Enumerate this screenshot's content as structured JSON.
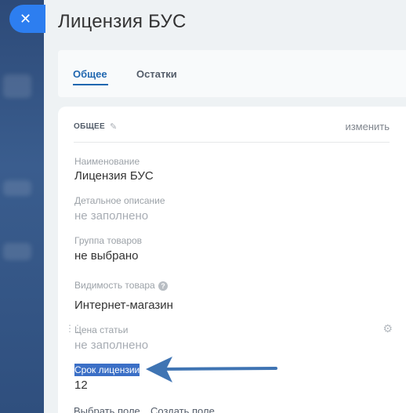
{
  "window": {
    "close_icon": "close-icon",
    "close_glyph": "✕"
  },
  "page": {
    "title": "Лицензия БУС"
  },
  "tabs": [
    {
      "label": "Общее",
      "active": true
    },
    {
      "label": "Остатки",
      "active": false
    }
  ],
  "section": {
    "header": "ОБЩЕЕ",
    "edit_label": "изменить",
    "fields": [
      {
        "label": "Наименование",
        "value": "Лицензия БУС"
      },
      {
        "label": "Детальное описание",
        "value": "не заполнено"
      },
      {
        "label": "Группа товаров",
        "value": "не выбрано"
      },
      {
        "label": "Видимость товара",
        "value": "Интернет-магазин",
        "help_icon": "help-icon"
      },
      {
        "label": "Цена статьи",
        "value": "не заполнено"
      },
      {
        "label": "Срок лицензии",
        "value": "12",
        "highlighted": true
      }
    ],
    "footer_links": [
      "Выбрать поле",
      "Создать поле"
    ]
  },
  "colors": {
    "accent": "#2067b0",
    "close_button": "#2d7ef0",
    "highlight": "#3b6fc6",
    "arrow": "#3f74b3"
  }
}
